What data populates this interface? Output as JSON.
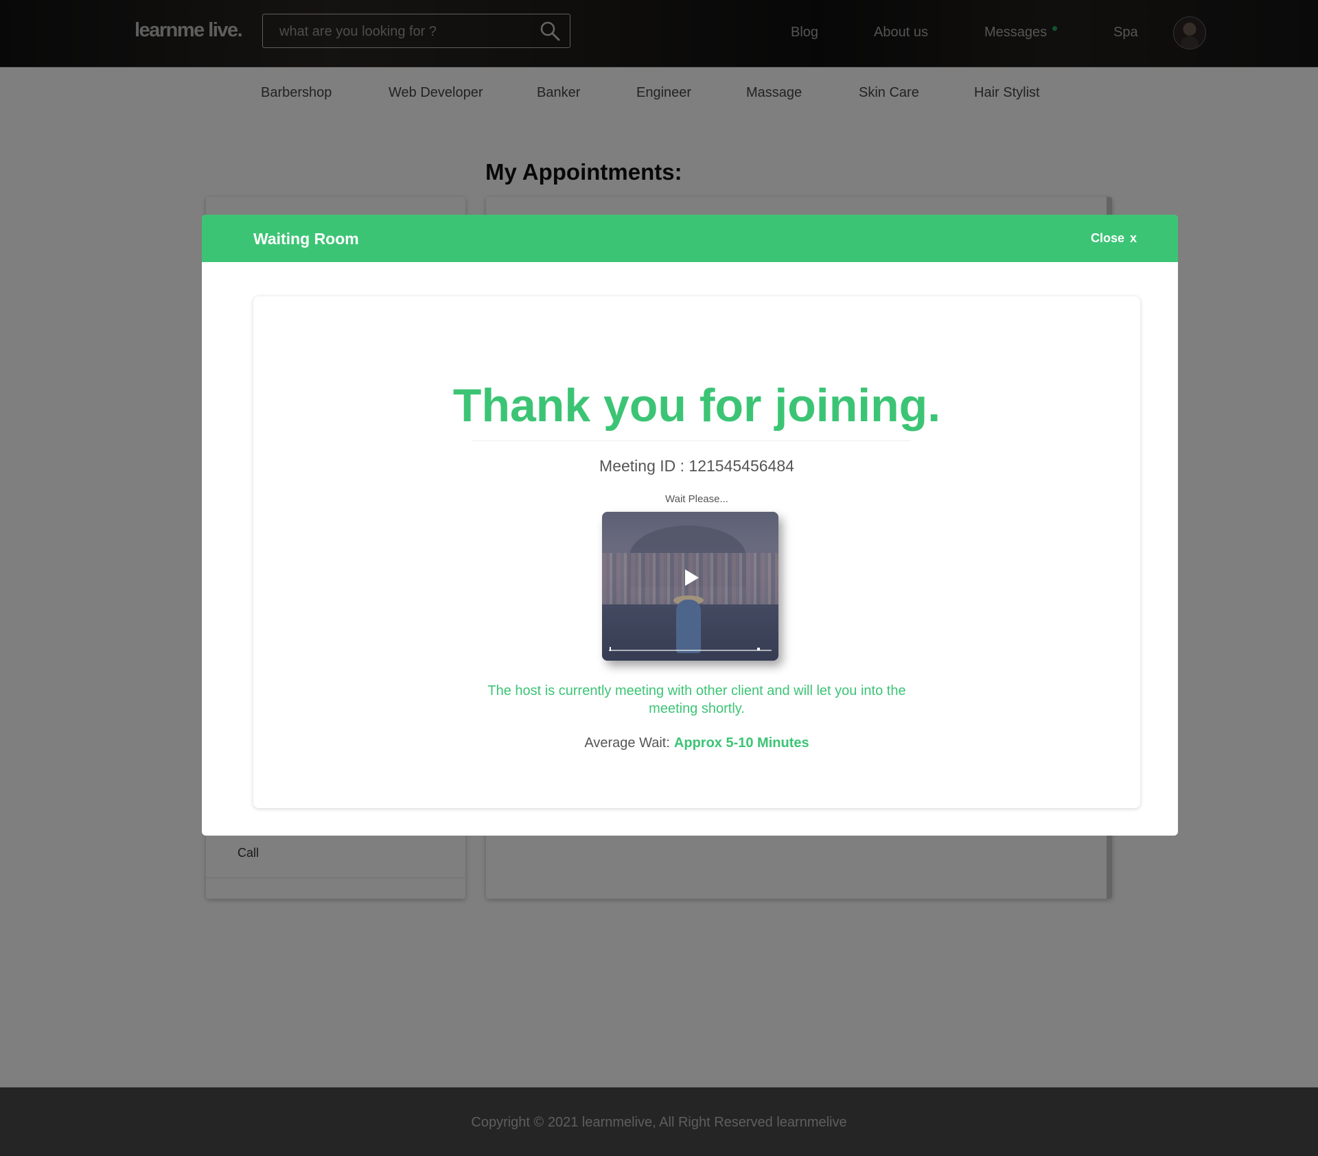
{
  "header": {
    "logo": "learnme live.",
    "search": {
      "placeholder": "what are you looking for ?"
    },
    "nav": [
      {
        "label": "Blog"
      },
      {
        "label": "About us"
      },
      {
        "label": "Messages"
      },
      {
        "label": "Spa"
      }
    ]
  },
  "categories": [
    {
      "label": "Barbershop"
    },
    {
      "label": "Web Developer"
    },
    {
      "label": "Banker"
    },
    {
      "label": "Engineer"
    },
    {
      "label": "Massage"
    },
    {
      "label": "Skin Care"
    },
    {
      "label": "Hair Stylist"
    }
  ],
  "page": {
    "title": "My Appointments:",
    "left_items": [
      {
        "label": "Call"
      }
    ]
  },
  "modal": {
    "title": "Waiting Room",
    "close_label": "Close",
    "close_symbol": "x",
    "heading": "Thank you for joining.",
    "meeting_id": "Meeting ID : 121545456484",
    "wait_text": "Wait Please...",
    "host_message": "The host is currently meeting with other client and will let you into the meeting shortly.",
    "average_wait_label": "Average Wait:",
    "average_wait_value": "Approx 5-10 Minutes"
  },
  "footer": {
    "copyright": "Copyright © 2021 learnmelive, All Right Reserved learnmelive"
  },
  "icons": {
    "search": "search-icon",
    "play": "play-icon",
    "avatar": "avatar"
  },
  "colors": {
    "accent": "#3cc475",
    "notification_dot": "#1fa85a",
    "footer": "#4a4a4a"
  }
}
